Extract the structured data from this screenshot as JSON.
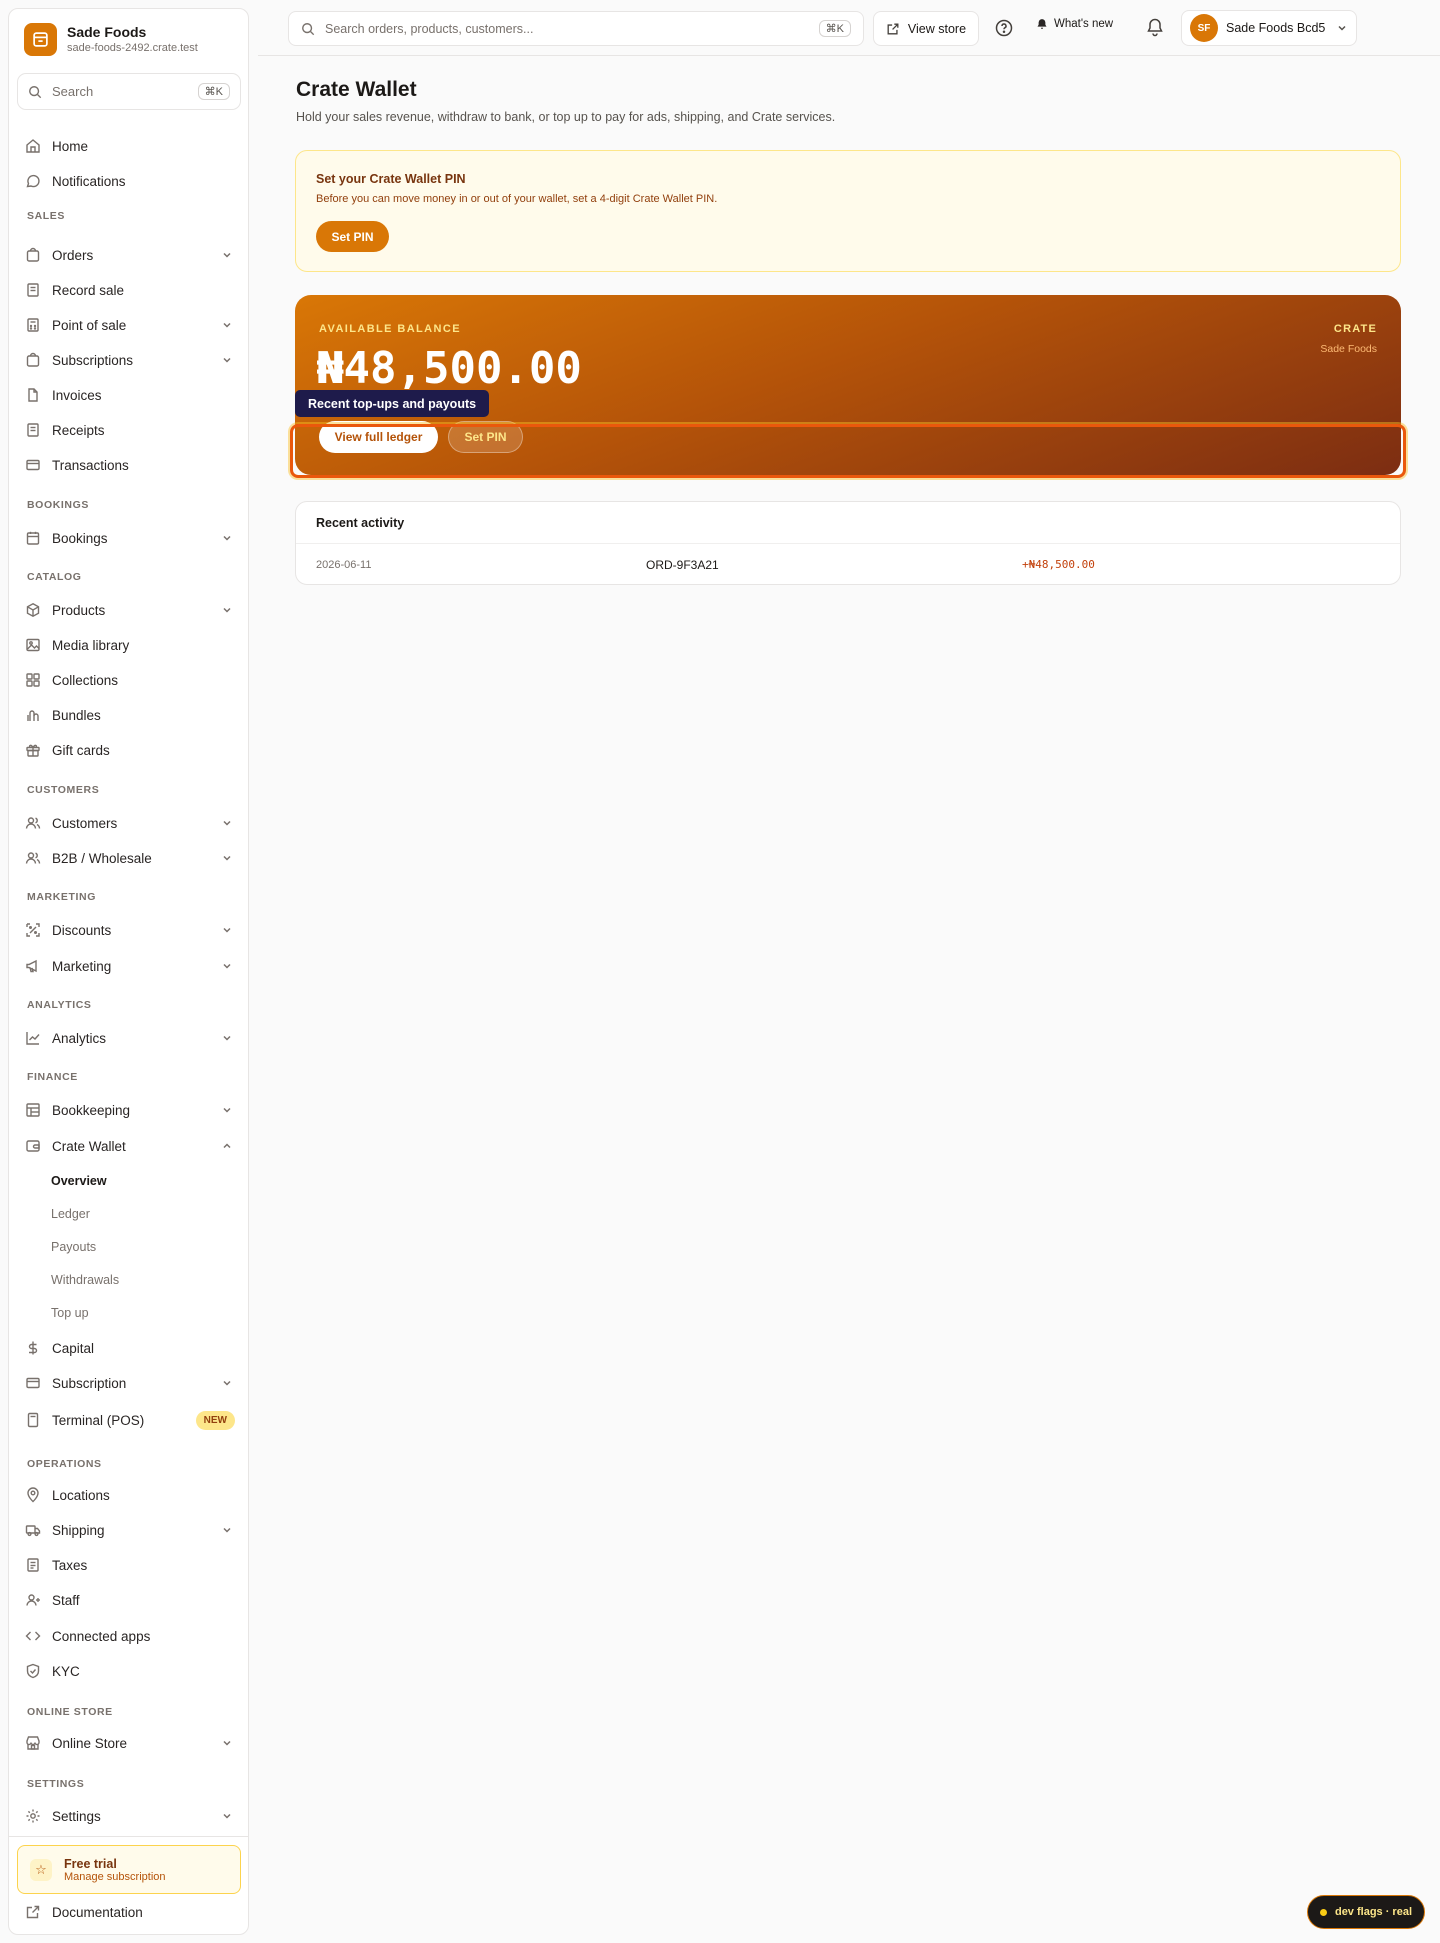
{
  "brand": {
    "name": "Sade Foods",
    "domain": "sade-foods-2492.crate.test"
  },
  "sidebar_search": {
    "placeholder": "Search",
    "shortcut": "⌘K"
  },
  "nav": {
    "home": "Home",
    "notifications": "Notifications",
    "sections": {
      "sales": "SALES",
      "bookings": "BOOKINGS",
      "catalog": "CATALOG",
      "customers": "CUSTOMERS",
      "marketing": "MARKETING",
      "analytics": "ANALYTICS",
      "finance": "FINANCE",
      "operations": "OPERATIONS",
      "online_store": "ONLINE STORE",
      "settings": "SETTINGS"
    },
    "orders": "Orders",
    "record_sale": "Record sale",
    "point_of_sale": "Point of sale",
    "subscriptions": "Subscriptions",
    "invoices": "Invoices",
    "receipts": "Receipts",
    "transactions": "Transactions",
    "bookings": "Bookings",
    "products": "Products",
    "media_library": "Media library",
    "collections": "Collections",
    "bundles": "Bundles",
    "gift_cards": "Gift cards",
    "customers": "Customers",
    "b2b": "B2B / Wholesale",
    "discounts": "Discounts",
    "marketing": "Marketing",
    "analytics": "Analytics",
    "bookkeeping": "Bookkeeping",
    "crate_wallet": "Crate Wallet",
    "wallet_sub": {
      "overview": "Overview",
      "ledger": "Ledger",
      "payouts": "Payouts",
      "withdrawals": "Withdrawals",
      "top_up": "Top up"
    },
    "capital": "Capital",
    "subscription": "Subscription",
    "terminal": "Terminal (POS)",
    "terminal_badge": "NEW",
    "locations": "Locations",
    "shipping": "Shipping",
    "taxes": "Taxes",
    "staff": "Staff",
    "connected_apps": "Connected apps",
    "kyc": "KYC",
    "online_store": "Online Store",
    "settings": "Settings"
  },
  "trial": {
    "title": "Free trial",
    "subtitle": "Manage subscription"
  },
  "documentation": "Documentation",
  "topbar": {
    "search_placeholder": "Search orders, products, customers...",
    "search_shortcut": "⌘K",
    "view_store": "View store",
    "whats_new": "What's new",
    "account_initials": "SF",
    "account_name": "Sade Foods Bcd5"
  },
  "page": {
    "title": "Crate Wallet",
    "subtitle": "Hold your sales revenue, withdraw to bank, or top up to pay for ads, shipping, and Crate services."
  },
  "pin_notice": {
    "title": "Set your Crate Wallet PIN",
    "description": "Before you can move money in or out of your wallet, set a 4-digit Crate Wallet PIN.",
    "button": "Set PIN"
  },
  "balance": {
    "label": "AVAILABLE BALANCE",
    "amount": "₦48,500.00",
    "brand": "CRATE",
    "brand_sub": "Sade Foods",
    "ledger_button": "View full ledger",
    "pin_button": "Set PIN",
    "tooltip": "Recent top-ups and payouts"
  },
  "activity": {
    "title": "Recent activity",
    "rows": [
      {
        "date": "2026-06-11",
        "ref": "ORD-9F3A21",
        "amount": "+₦48,500.00"
      }
    ]
  },
  "dev_flags": "dev flags · real",
  "colors": {
    "accent": "#d97706",
    "accent_dark": "#7c2d12",
    "notice_bg": "#fffbeb",
    "tooltip_bg": "#1e1b4b"
  }
}
